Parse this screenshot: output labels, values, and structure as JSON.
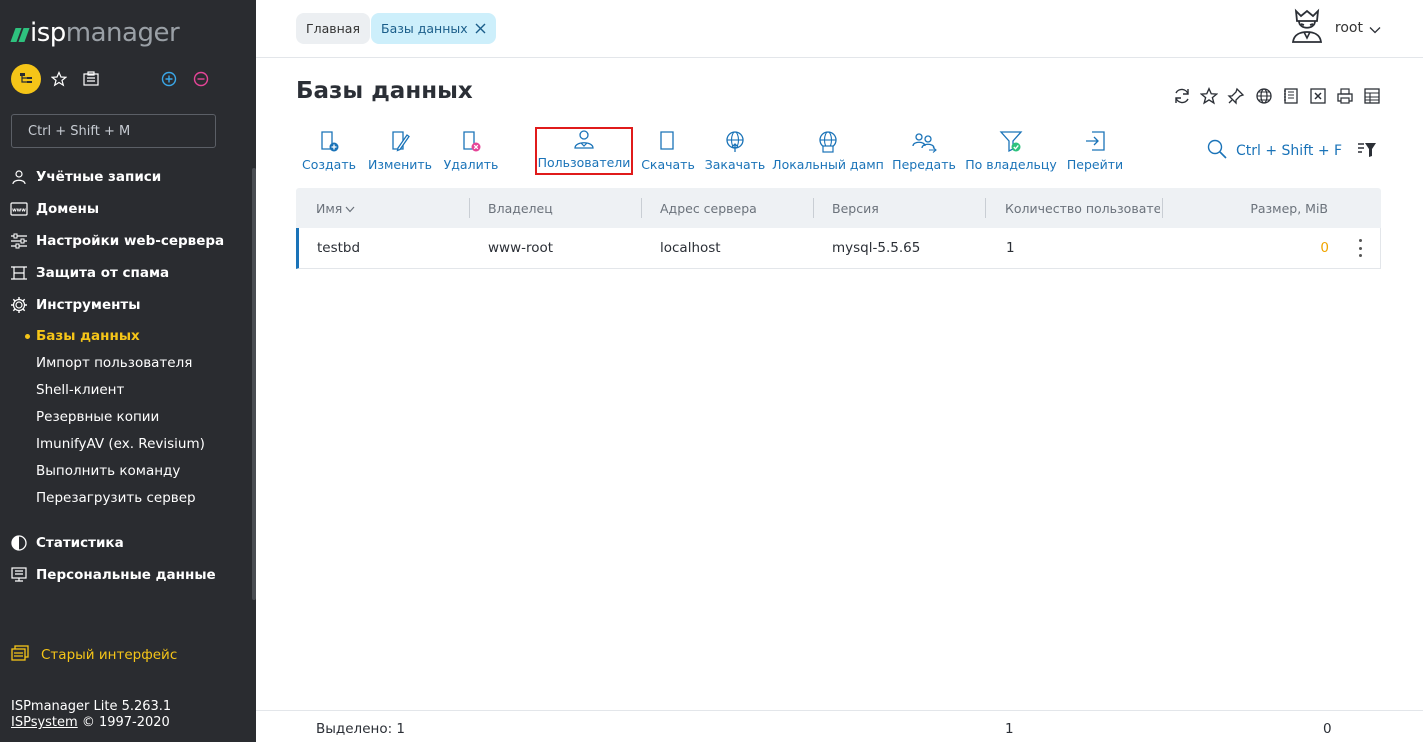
{
  "brand": {
    "logo_part1": "isp",
    "logo_part2": "manager"
  },
  "sidebar": {
    "search_placeholder": "Ctrl + Shift + M",
    "menu": [
      {
        "label": "Учётные записи",
        "icon": "user-icon"
      },
      {
        "label": "Домены",
        "icon": "www-icon"
      },
      {
        "label": "Настройки web-сервера",
        "icon": "sliders-icon"
      },
      {
        "label": "Защита от спама",
        "icon": "spam-filter-icon"
      },
      {
        "label": "Инструменты",
        "icon": "gear-icon"
      }
    ],
    "tools_submenu": [
      {
        "label": "Базы данных",
        "active": true
      },
      {
        "label": "Импорт пользователя"
      },
      {
        "label": "Shell-клиент"
      },
      {
        "label": "Резервные копии"
      },
      {
        "label": "ImunifyAV (ex. Revisium)"
      },
      {
        "label": "Выполнить команду"
      },
      {
        "label": "Перезагрузить сервер"
      }
    ],
    "menu_bottom": [
      {
        "label": "Статистика",
        "icon": "pie-chart-icon"
      },
      {
        "label": "Персональные данные",
        "icon": "personal-data-icon"
      }
    ],
    "old_interface": "Старый интерфейс",
    "version": "ISPmanager Lite 5.263.1",
    "copyright_company": "ISPsystem",
    "copyright_years": " © 1997-2020"
  },
  "header": {
    "breadcrumbs": [
      {
        "label": "Главная"
      },
      {
        "label": "Базы данных"
      }
    ],
    "username": "root"
  },
  "page": {
    "title": "Базы данных"
  },
  "toolbar": {
    "buttons": [
      {
        "label": "Создать",
        "icon": "create-icon"
      },
      {
        "label": "Изменить",
        "icon": "edit-icon"
      },
      {
        "label": "Удалить",
        "icon": "delete-icon"
      },
      {
        "label": "Пользователи",
        "icon": "users-icon",
        "highlighted": true
      },
      {
        "label": "Скачать",
        "icon": "download-icon"
      },
      {
        "label": "Закачать",
        "icon": "upload-icon"
      },
      {
        "label": "Локальный дамп",
        "icon": "local-dump-icon"
      },
      {
        "label": "Передать",
        "icon": "transfer-icon"
      },
      {
        "label": "По владельцу",
        "icon": "owner-filter-icon"
      },
      {
        "label": "Перейти",
        "icon": "goto-icon"
      }
    ],
    "search_label": "Ctrl + Shift + F"
  },
  "table": {
    "columns": [
      "Имя",
      "Владелец",
      "Адрес сервера",
      "Версия",
      "Количество пользователей",
      "Размер, MiB"
    ],
    "rows": [
      {
        "name": "testbd",
        "owner": "www-root",
        "server": "localhost",
        "version": "mysql-5.5.65",
        "users": "1",
        "size": "0"
      }
    ]
  },
  "footer": {
    "selected": "Выделено: 1",
    "users_total": "1",
    "size_total": "0"
  },
  "colors": {
    "sidebar_bg": "#2a2c30",
    "accent_yellow": "#f5c518",
    "link_blue": "#1a73b8",
    "highlight_red": "#e01b1b",
    "size_orange": "#f0a500"
  }
}
